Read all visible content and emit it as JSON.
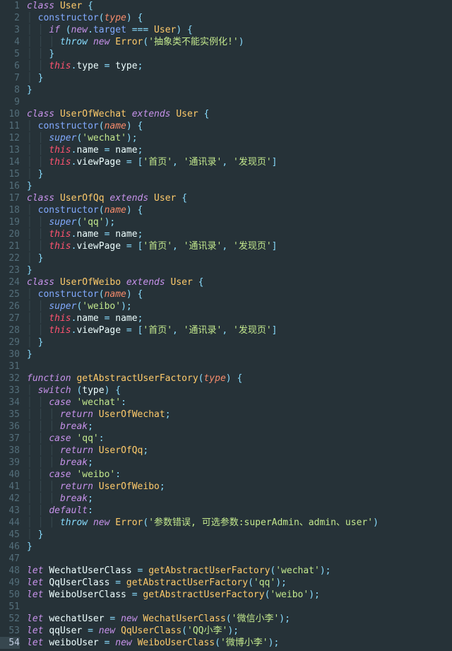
{
  "editor": {
    "highlighted_line": 54,
    "line_count": 54,
    "line_numbers": [
      "1",
      "2",
      "3",
      "4",
      "5",
      "6",
      "7",
      "8",
      "9",
      "10",
      "11",
      "12",
      "13",
      "14",
      "15",
      "16",
      "17",
      "18",
      "19",
      "20",
      "21",
      "22",
      "23",
      "24",
      "25",
      "26",
      "27",
      "28",
      "29",
      "30",
      "31",
      "32",
      "33",
      "34",
      "35",
      "36",
      "37",
      "38",
      "39",
      "40",
      "41",
      "42",
      "43",
      "44",
      "45",
      "46",
      "47",
      "48",
      "49",
      "50",
      "51",
      "52",
      "53",
      "54"
    ]
  },
  "source": {
    "language": "javascript",
    "plain": "class User {\n  constructor(type) {\n    if (new.target === User) {\n      throw new Error('抽象类不能实例化!')\n    }\n    this.type = type;\n  }\n}\n\nclass UserOfWechat extends User {\n  constructor(name) {\n    super('wechat');\n    this.name = name;\n    this.viewPage = ['首页', '通讯录', '发现页']\n  }\n}\nclass UserOfQq extends User {\n  constructor(name) {\n    super('qq');\n    this.name = name;\n    this.viewPage = ['首页', '通讯录', '发现页']\n  }\n}\nclass UserOfWeibo extends User {\n  constructor(name) {\n    super('weibo');\n    this.name = name;\n    this.viewPage = ['首页', '通讯录', '发现页']\n  }\n}\n\nfunction getAbstractUserFactory(type) {\n  switch (type) {\n    case 'wechat':\n      return UserOfWechat;\n      break;\n    case 'qq':\n      return UserOfQq;\n      break;\n    case 'weibo':\n      return UserOfWeibo;\n      break;\n    default:\n      throw new Error('参数错误, 可选参数:superAdmin、admin、user')\n  }\n}\n\nlet WechatUserClass = getAbstractUserFactory('wechat');\nlet QqUserClass = getAbstractUserFactory('qq');\nlet WeiboUserClass = getAbstractUserFactory('weibo');\n\nlet wechatUser = new WechatUserClass('微信小李');\nlet qqUser = new QqUserClass('QQ小李');\nlet weiboUser = new WeiboUserClass('微博小李');"
  },
  "strings": {
    "err_abstract": "'抽象类不能实例化!'",
    "wechat": "'wechat'",
    "qq": "'qq'",
    "weibo": "'weibo'",
    "page_home": "'首页'",
    "page_contacts": "'通讯录'",
    "page_discover": "'发现页'",
    "err_params": "'参数错误, 可选参数:superAdmin、admin、user'",
    "wx_user": "'微信小李'",
    "qq_user": "'QQ小李'",
    "wb_user": "'微博小李'"
  },
  "kw": {
    "class": "class",
    "extends": "extends",
    "if": "if",
    "new": "new",
    "throw": "throw",
    "switch": "switch",
    "case": "case",
    "return": "return",
    "break": "break",
    "default": "default",
    "let": "let",
    "function": "function",
    "this": "this",
    "super": "super",
    "constructor": "constructor",
    "target": "target"
  },
  "ident": {
    "User": "User",
    "UserOfWechat": "UserOfWechat",
    "UserOfQq": "UserOfQq",
    "UserOfWeibo": "UserOfWeibo",
    "Error": "Error",
    "getAbstractUserFactory": "getAbstractUserFactory",
    "WechatUserClass": "WechatUserClass",
    "QqUserClass": "QqUserClass",
    "WeiboUserClass": "WeiboUserClass",
    "wechatUser": "wechatUser",
    "qqUser": "qqUser",
    "weiboUser": "weiboUser",
    "type": "type",
    "name": "name",
    "viewPage": "viewPage"
  }
}
